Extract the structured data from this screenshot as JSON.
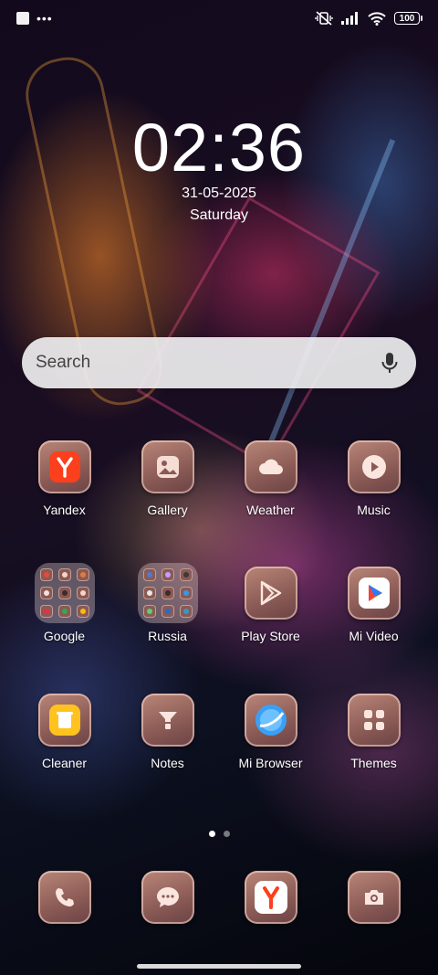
{
  "status_bar": {
    "battery": "100",
    "left_icons": [
      "notification-square-icon",
      "more-dots-icon"
    ],
    "right_icons": [
      "vibrate-silent-icon",
      "signal-icon",
      "wifi-icon",
      "battery-icon"
    ],
    "more": "•••"
  },
  "lockscreen": {
    "time": "02:36",
    "date": "31-05-2025",
    "weekday": "Saturday"
  },
  "search": {
    "placeholder": "Search",
    "icon": "microphone-icon"
  },
  "apps": [
    {
      "label": "Yandex",
      "icon": "yandex-icon"
    },
    {
      "label": "Gallery",
      "icon": "gallery-icon"
    },
    {
      "label": "Weather",
      "icon": "cloud-icon"
    },
    {
      "label": "Music",
      "icon": "play-circle-icon"
    },
    {
      "label": "Google",
      "icon": "folder-icon"
    },
    {
      "label": "Russia",
      "icon": "folder-icon"
    },
    {
      "label": "Play Store",
      "icon": "play-store-icon"
    },
    {
      "label": "Mi Video",
      "icon": "mi-video-icon"
    },
    {
      "label": "Cleaner",
      "icon": "trash-icon"
    },
    {
      "label": "Notes",
      "icon": "notes-icon"
    },
    {
      "label": "Mi Browser",
      "icon": "browser-icon"
    },
    {
      "label": "Themes",
      "icon": "themes-icon"
    }
  ],
  "dock": [
    {
      "icon": "phone-icon"
    },
    {
      "icon": "messages-icon"
    },
    {
      "icon": "yandex-browser-icon"
    },
    {
      "icon": "camera-icon"
    }
  ],
  "pages": {
    "count": 2,
    "current": 1
  },
  "colors": {
    "icon_tile": "#9a6a62",
    "yandex_red": "#fc3f1d",
    "search_bg": "#eeeef0"
  }
}
